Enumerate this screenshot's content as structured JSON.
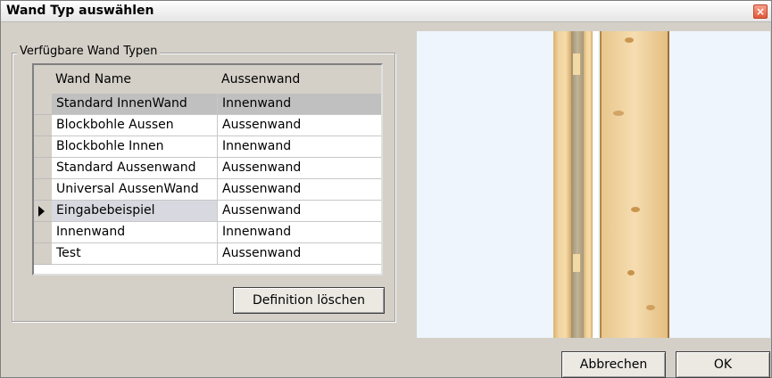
{
  "window": {
    "title": "Wand Typ auswählen",
    "close_glyph": "×"
  },
  "group": {
    "legend": "Verfügbare Wand Typen"
  },
  "table": {
    "columns": [
      "Wand Name",
      "Aussenwand"
    ],
    "rows": [
      {
        "name": "Standard InnenWand",
        "type": "Innenwand"
      },
      {
        "name": "Blockbohle Aussen",
        "type": "Aussenwand"
      },
      {
        "name": "Blockbohle Innen",
        "type": "Innenwand"
      },
      {
        "name": "Standard Aussenwand",
        "type": "Aussenwand"
      },
      {
        "name": "Universal AussenWand",
        "type": "Aussenwand"
      },
      {
        "name": "Eingabebeispiel",
        "type": "Aussenwand"
      },
      {
        "name": "Innenwand",
        "type": "Innenwand"
      },
      {
        "name": "Test",
        "type": "Aussenwand"
      }
    ],
    "selected_row": 0,
    "current_row": 5
  },
  "buttons": {
    "delete_definition": "Definition löschen",
    "cancel": "Abbrechen",
    "ok": "OK"
  },
  "colors": {
    "preview_background": "#eef5fc",
    "wood_light": "#f0d39c",
    "wood_dark": "#b98f4e",
    "insulation": "#b5a58a",
    "dialog_background": "#d4d0c8"
  },
  "icons": {
    "row_indicator": "triangle-right",
    "close": "close-icon"
  }
}
